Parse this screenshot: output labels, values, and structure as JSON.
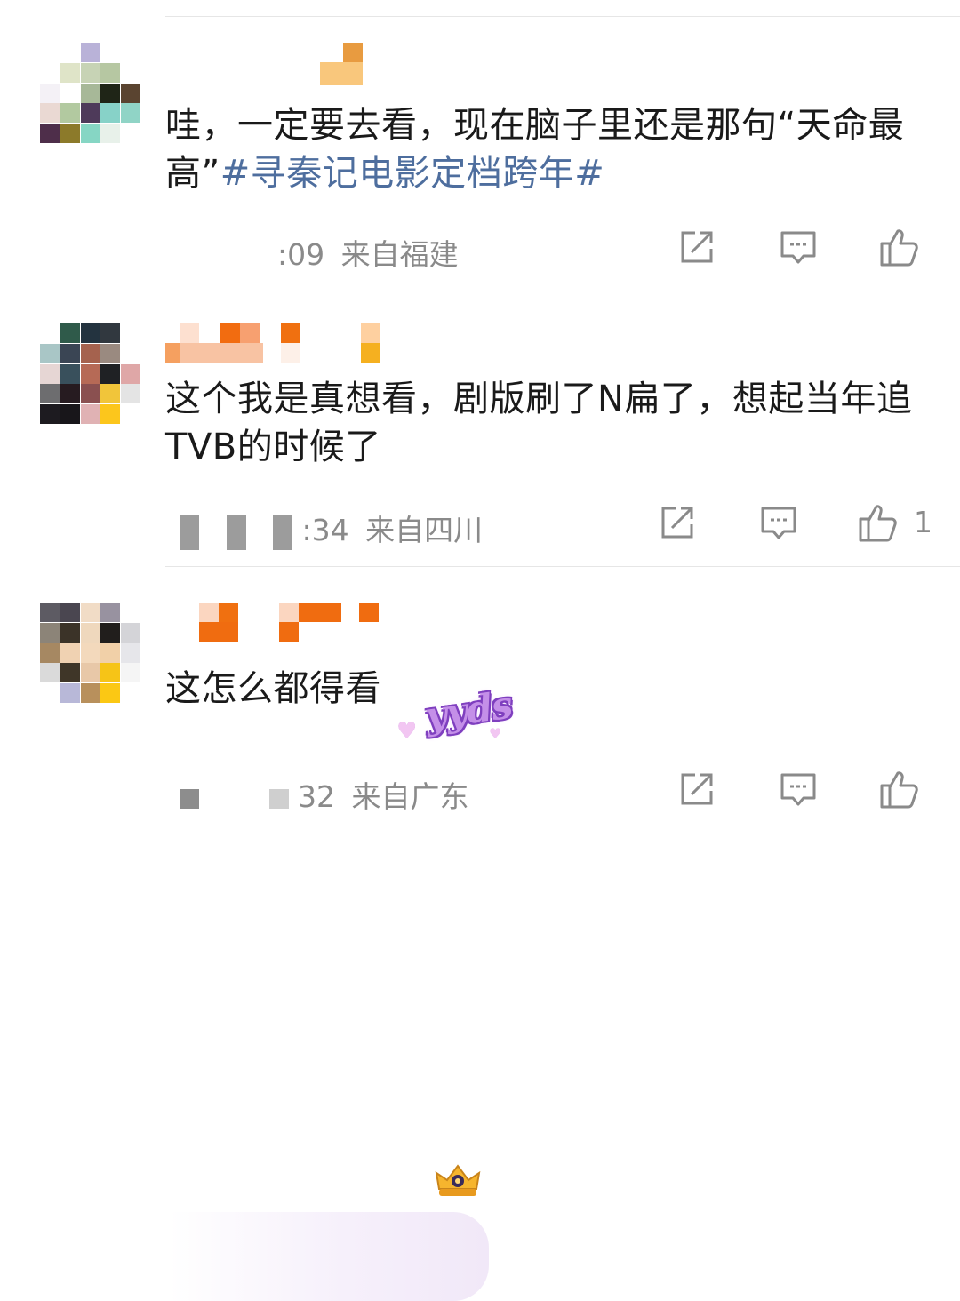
{
  "comments": [
    {
      "text": "哇，一定要去看，现在脑子里还是那句“天命最高”",
      "hashtag": "#寻秦记电影定档跨年#",
      "meta_time": ":09",
      "meta_location": "来自福建",
      "like_count": ""
    },
    {
      "text": "这个我是真想看，剧版刷了N扁了，想起当年追TVB的时候了",
      "hashtag": "",
      "meta_time": ":34",
      "meta_location": "来自四川",
      "like_count": "1"
    },
    {
      "text": "这怎么都得看",
      "hashtag": "",
      "meta_time": "32",
      "meta_location": "来自广东",
      "like_count": "",
      "sticker_text": "yyds"
    }
  ],
  "icons": {
    "share": "share-icon",
    "comment": "comment-icon",
    "like": "thumbs-up-icon",
    "badge": "crown-badge-icon"
  },
  "colors": {
    "hashtag": "#4e6e9e",
    "meta": "#8a8a8a",
    "name_orange": "#f07d1b"
  }
}
